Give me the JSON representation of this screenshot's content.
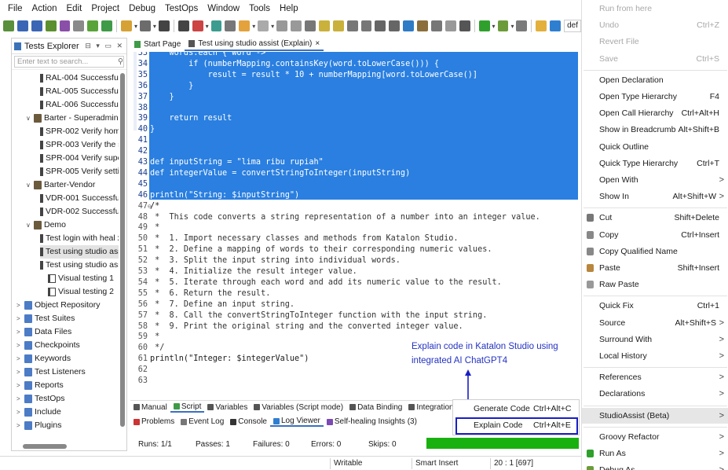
{
  "menubar": [
    "File",
    "Action",
    "Edit",
    "Project",
    "Debug",
    "TestOps",
    "Window",
    "Tools",
    "Help"
  ],
  "toolbar": {
    "profile_label": "def"
  },
  "explorer": {
    "title": "Tests Explorer",
    "filter_placeholder": "Enter text to search...",
    "tree": [
      {
        "label": "RAL-004 Successfull r",
        "type": "tc"
      },
      {
        "label": "RAL-005 Successfull r",
        "type": "tc"
      },
      {
        "label": "RAL-006 Successfull r",
        "type": "tc"
      },
      {
        "label": "Barter - Superadmin",
        "type": "folder",
        "toggle": "∨"
      },
      {
        "label": "SPR-002 Verify home",
        "type": "tc"
      },
      {
        "label": "SPR-003 Verify the se",
        "type": "tc"
      },
      {
        "label": "SPR-004 Verify super",
        "type": "tc"
      },
      {
        "label": "SPR-005 Verify setting",
        "type": "tc"
      },
      {
        "label": "Barter-Vendor",
        "type": "folder",
        "toggle": "∨"
      },
      {
        "label": "VDR-001 Successfull r",
        "type": "tc"
      },
      {
        "label": "VDR-002 Successfull r",
        "type": "tc"
      },
      {
        "label": "Demo",
        "type": "folder",
        "toggle": "∨"
      },
      {
        "label": "Test login with heal xp",
        "type": "tc"
      },
      {
        "label": "Test using studio assis",
        "type": "tc",
        "selected": true
      },
      {
        "label": "Test using studio assis",
        "type": "tc"
      },
      {
        "label": "Visual testing 1",
        "type": "tc"
      },
      {
        "label": "Visual testing 2",
        "type": "tc"
      },
      {
        "label": "Object Repository",
        "type": "root",
        "toggle": ">"
      },
      {
        "label": "Test Suites",
        "type": "root",
        "toggle": ">"
      },
      {
        "label": "Data Files",
        "type": "root",
        "toggle": ">"
      },
      {
        "label": "Checkpoints",
        "type": "root",
        "toggle": ">"
      },
      {
        "label": "Keywords",
        "type": "root",
        "toggle": ">"
      },
      {
        "label": "Test Listeners",
        "type": "root",
        "toggle": ">"
      },
      {
        "label": "Reports",
        "type": "root",
        "toggle": ">"
      },
      {
        "label": "TestOps",
        "type": "root",
        "toggle": ">"
      },
      {
        "label": "Include",
        "type": "root",
        "toggle": ">"
      },
      {
        "label": "Plugins",
        "type": "root",
        "toggle": ">"
      }
    ]
  },
  "editor": {
    "tabs": [
      {
        "label": "Start Page",
        "active": false
      },
      {
        "label": "Test using studio assist (Explain)",
        "active": true,
        "close": "×"
      }
    ],
    "lines": [
      {
        "n": "33",
        "text": "    words.each { word ->",
        "sel": true
      },
      {
        "n": "34",
        "text": "        if (numberMapping.containsKey(word.toLowerCase())) {",
        "sel": true
      },
      {
        "n": "35",
        "text": "            result = result * 10 + numberMapping[word.toLowerCase()]",
        "sel": true
      },
      {
        "n": "36",
        "text": "        }",
        "sel": true
      },
      {
        "n": "37",
        "text": "    }",
        "sel": true
      },
      {
        "n": "38",
        "text": "",
        "sel": true
      },
      {
        "n": "39",
        "text": "    return result",
        "sel": true
      },
      {
        "n": "40",
        "text": "}",
        "sel": true
      },
      {
        "n": "41",
        "text": "",
        "sel": true
      },
      {
        "n": "42",
        "text": "",
        "sel": true
      },
      {
        "n": "43",
        "text": "def inputString = \"lima ribu rupiah\"",
        "sel": true
      },
      {
        "n": "44",
        "text": "def integerValue = convertStringToInteger(inputString)",
        "sel": true
      },
      {
        "n": "45",
        "text": "",
        "sel": true
      },
      {
        "n": "46",
        "text": "println(\"String: $inputString\")",
        "sel": true
      },
      {
        "n": "47",
        "text": "/*",
        "sel": false,
        "fold": "⊖"
      },
      {
        "n": "48",
        "text": " *  This code converts a string representation of a number into an integer value.",
        "sel": false
      },
      {
        "n": "49",
        "text": " *",
        "sel": false
      },
      {
        "n": "50",
        "text": " *  1. Import necessary classes and methods from Katalon Studio.",
        "sel": false
      },
      {
        "n": "51",
        "text": " *  2. Define a mapping of words to their corresponding numeric values.",
        "sel": false
      },
      {
        "n": "52",
        "text": " *  3. Split the input string into individual words.",
        "sel": false
      },
      {
        "n": "53",
        "text": " *  4. Initialize the result integer value.",
        "sel": false
      },
      {
        "n": "54",
        "text": " *  5. Iterate through each word and add its numeric value to the result.",
        "sel": false
      },
      {
        "n": "55",
        "text": " *  6. Return the result.",
        "sel": false
      },
      {
        "n": "56",
        "text": " *  7. Define an input string.",
        "sel": false
      },
      {
        "n": "57",
        "text": " *  8. Call the convertStringToInteger function with the input string.",
        "sel": false
      },
      {
        "n": "58",
        "text": " *  9. Print the original string and the converted integer value.",
        "sel": false
      },
      {
        "n": "59",
        "text": " *",
        "sel": false
      },
      {
        "n": "60",
        "text": " */",
        "sel": false
      },
      {
        "n": "61",
        "text": "println(\"Integer: $integerValue\")",
        "sel": false
      },
      {
        "n": "62",
        "text": "",
        "sel": false
      },
      {
        "n": "63",
        "text": "",
        "sel": false
      }
    ]
  },
  "bottom_tabs_1": [
    "Manual",
    "Script",
    "Variables",
    "Variables (Script mode)",
    "Data Binding",
    "Integration",
    "Properties"
  ],
  "bottom_tabs_2": [
    "Problems",
    "Event Log",
    "Console",
    "Log Viewer",
    "Self-healing Insights (3)"
  ],
  "run_status": {
    "runs": "Runs: 1/1",
    "passes": "Passes: 1",
    "failures": "Failures: 0",
    "errors": "Errors: 0",
    "skips": "Skips: 0",
    "progress": 1.0,
    "color": "#19b10f"
  },
  "statusbar": {
    "writable": "Writable",
    "insert": "Smart Insert",
    "position": "20 : 1 [697]"
  },
  "annotation": {
    "line1": "Explain code in Katalon Studio using",
    "line2": "integrated AI ChatGPT4",
    "color": "#2433c2"
  },
  "submenu": [
    {
      "label": "Generate Code",
      "shortcut": "Ctrl+Alt+C"
    },
    {
      "label": "Explain Code",
      "shortcut": "Ctrl+Alt+E",
      "highlighted": true
    }
  ],
  "context_menu": [
    {
      "label": "Run from here",
      "disabled": true
    },
    {
      "label": "Undo",
      "shortcut": "Ctrl+Z",
      "disabled": true
    },
    {
      "label": "Revert File",
      "disabled": true
    },
    {
      "label": "Save",
      "shortcut": "Ctrl+S",
      "disabled": true
    },
    {
      "sep": true
    },
    {
      "label": "Open Declaration"
    },
    {
      "label": "Open Type Hierarchy",
      "shortcut": "F4"
    },
    {
      "label": "Open Call Hierarchy",
      "shortcut": "Ctrl+Alt+H"
    },
    {
      "label": "Show in Breadcrumb",
      "shortcut": "Alt+Shift+B"
    },
    {
      "label": "Quick Outline"
    },
    {
      "label": "Quick Type Hierarchy",
      "shortcut": "Ctrl+T"
    },
    {
      "label": "Open With",
      "arrow": ">"
    },
    {
      "label": "Show In",
      "shortcut": "Alt+Shift+W",
      "arrow": ">"
    },
    {
      "sep": true
    },
    {
      "label": "Cut",
      "shortcut": "Shift+Delete",
      "icon": "scissors-icon"
    },
    {
      "label": "Copy",
      "shortcut": "Ctrl+Insert",
      "icon": "copy-icon"
    },
    {
      "label": "Copy Qualified Name",
      "icon": "copy-qualified-icon"
    },
    {
      "label": "Paste",
      "shortcut": "Shift+Insert",
      "icon": "paste-icon"
    },
    {
      "label": "Raw Paste",
      "icon": "raw-paste-icon"
    },
    {
      "sep": true
    },
    {
      "label": "Quick Fix",
      "shortcut": "Ctrl+1"
    },
    {
      "label": "Source",
      "shortcut": "Alt+Shift+S",
      "arrow": ">"
    },
    {
      "label": "Surround With",
      "arrow": ">"
    },
    {
      "label": "Local History",
      "arrow": ">"
    },
    {
      "sep": true
    },
    {
      "label": "References",
      "arrow": ">"
    },
    {
      "label": "Declarations",
      "arrow": ">"
    },
    {
      "sep": true
    },
    {
      "label": "StudioAssist (Beta)",
      "arrow": ">",
      "highlighted": true
    },
    {
      "sep": true
    },
    {
      "label": "Groovy Refactor",
      "arrow": ">"
    },
    {
      "label": "Run As",
      "arrow": ">",
      "icon": "run-icon"
    },
    {
      "label": "Debug As",
      "arrow": ">",
      "icon": "debug-icon"
    }
  ]
}
